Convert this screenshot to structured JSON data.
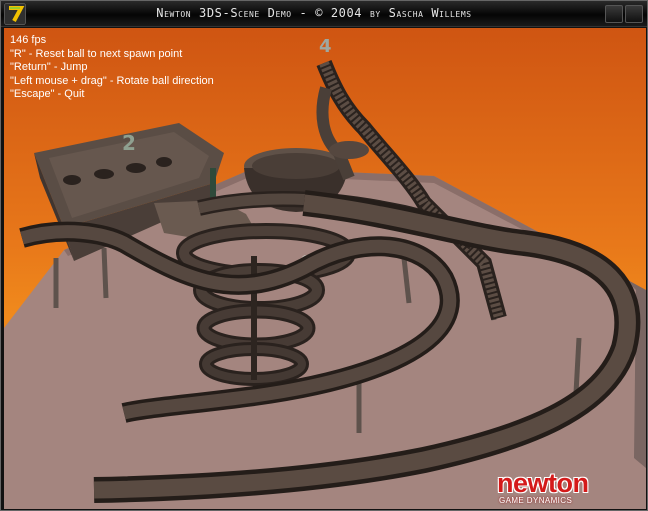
{
  "window": {
    "title": "Newton 3DS-Scene Demo - © 2004 by Sascha Willems"
  },
  "hud": {
    "fps": "146 fps",
    "help_lines": [
      "\"R\" - Reset ball to next spawn point",
      "\"Return\" - Jump",
      "\"Left mouse + drag\" - Rotate ball direction",
      "\"Escape\" - Quit"
    ]
  },
  "scene": {
    "spawn_markers": [
      "2",
      "4"
    ],
    "colors": {
      "sky_top": "#cf5512",
      "sky_mid": "#f08a1c",
      "floor": "#a88a86",
      "track": "#4a3f38",
      "track_edge": "#2a221e"
    }
  },
  "logo": {
    "word": "newton",
    "tagline": "GAME DYNAMICS",
    "color": "#d41a1a"
  }
}
